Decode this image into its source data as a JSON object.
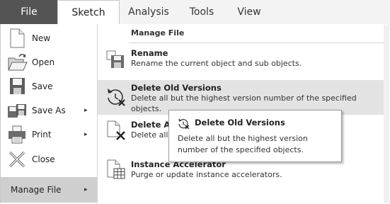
{
  "tabs": [
    "File",
    "Sketch",
    "Analysis",
    "Tools",
    "View"
  ],
  "left_menu": [
    {
      "label": "New",
      "icon": "new-document-icon",
      "arrow": ""
    },
    {
      "label": "Open",
      "icon": "open-folder-icon",
      "arrow": ""
    },
    {
      "label": "Save",
      "icon": "save-icon",
      "arrow": ""
    },
    {
      "label": "Save As",
      "icon": "save-as-icon",
      "arrow": "▸"
    },
    {
      "label": "Print",
      "icon": "printer-icon",
      "arrow": "▸"
    },
    {
      "label": "Close",
      "icon": "close-x-icon",
      "arrow": ""
    }
  ],
  "manage_file": {
    "label": "Manage File",
    "arrow": "▸"
  },
  "panel": {
    "heading": "Manage File",
    "items": [
      {
        "title": "Rename",
        "desc1": "Rename the current object and sub objects.",
        "desc2": ""
      },
      {
        "title": "Delete Old Versions",
        "desc1": "Delete all but the highest version number of the specified",
        "desc2": "objects."
      },
      {
        "title": "Delete All",
        "desc1": "Delete all v",
        "desc2": ""
      },
      {
        "title": "Instance Accelerator",
        "desc1": "Purge or update instance accelerators.",
        "desc2": ""
      }
    ]
  },
  "tooltip": {
    "title": "Delete Old Versions",
    "desc": "Delete all but the highest version number of the specified objects."
  }
}
